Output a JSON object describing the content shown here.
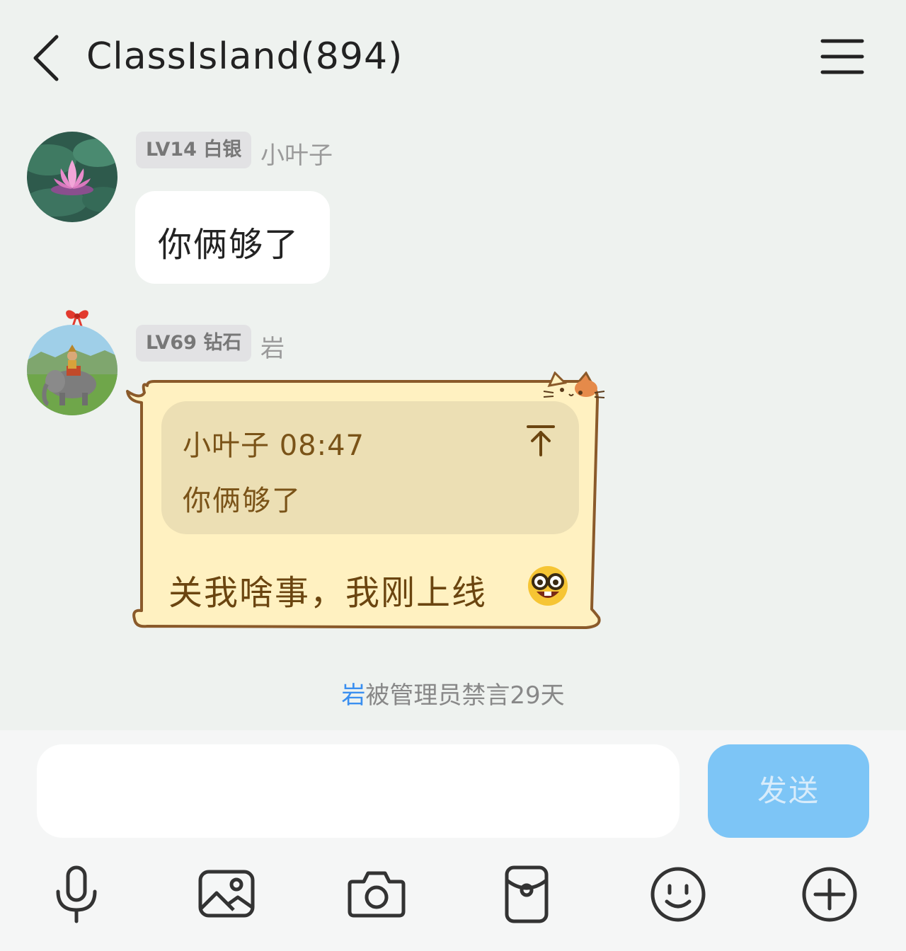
{
  "header": {
    "title": "ClassIsland(894)"
  },
  "messages": [
    {
      "level_badge": "LV14 白银",
      "nickname": "小叶子",
      "text": "你俩够了"
    },
    {
      "level_badge": "LV69 钻石",
      "nickname": "岩",
      "quote": {
        "author_time": "小叶子 08:47",
        "text": "你俩够了"
      },
      "text": "关我啥事，我刚上线"
    }
  ],
  "system_notice": {
    "name": "岩",
    "text": "被管理员禁言29天"
  },
  "composer": {
    "input_value": "",
    "send_label": "发送"
  },
  "toolbar_icons": [
    "microphone-icon",
    "image-icon",
    "camera-icon",
    "red-packet-icon",
    "emoji-icon",
    "plus-icon"
  ],
  "colors": {
    "background": "#eef2ef",
    "send_button": "#7dc5f6",
    "notice_name": "#3a8ff0",
    "cat_bubble_fill": "#fff1c1",
    "cat_bubble_text": "#6b4510"
  }
}
